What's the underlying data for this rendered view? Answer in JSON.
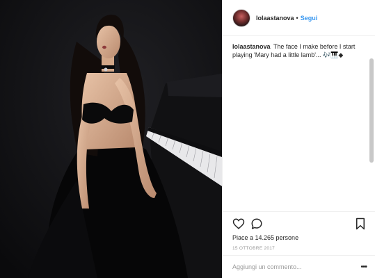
{
  "post": {
    "username": "lolaastanova",
    "separator": "•",
    "follow_label": "Segui",
    "caption_user": "lolaastanova",
    "caption_text": "The face I make before I start playing 'Mary had a little lamb'... 🎶🎹◆",
    "likes_text": "Piace a 14.265 persone",
    "date_text": "15 OTTOBRE 2017",
    "comment_placeholder": "Aggiungi un commento...",
    "more_label": "•••"
  },
  "icons": {
    "like": "heart-outline-icon",
    "comment": "speech-bubble-icon",
    "save": "bookmark-icon",
    "more": "ellipsis-icon"
  },
  "colors": {
    "follow": "#3897f0",
    "text": "#262626",
    "muted": "#999999",
    "border": "#efefef"
  }
}
